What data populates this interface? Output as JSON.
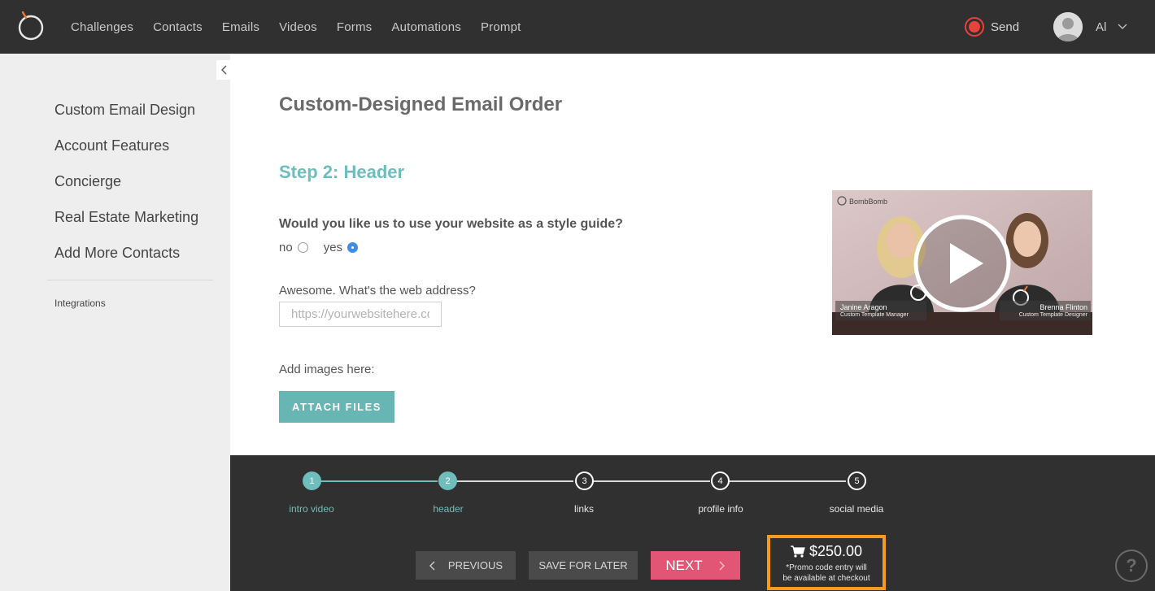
{
  "nav": {
    "items": [
      "Challenges",
      "Contacts",
      "Emails",
      "Videos",
      "Forms",
      "Automations",
      "Prompt"
    ],
    "send_label": "Send",
    "user_name": "Al"
  },
  "sidebar": {
    "items": [
      {
        "label": "Custom Email Design"
      },
      {
        "label": "Account Features"
      },
      {
        "label": "Concierge"
      },
      {
        "label": "Real Estate Marketing"
      },
      {
        "label": "Add More Contacts"
      }
    ],
    "secondary": "Integrations"
  },
  "main": {
    "title": "Custom-Designed Email Order",
    "step_title": "Step 2: Header",
    "question": "Would you like us to use your website as a style guide?",
    "option_no": "no",
    "option_yes": "yes",
    "selected": "yes",
    "web_label": "Awesome. What's the web address?",
    "web_placeholder": "https://yourwebsitehere.com",
    "web_value": "",
    "images_label": "Add images here:",
    "attach_label": "ATTACH FILES"
  },
  "video": {
    "brand": "BombBomb",
    "person_left_name": "Janine Aragon",
    "person_left_role": "Custom Template Manager",
    "person_right_name": "Brenna Flinton",
    "person_right_role": "Custom Template Designer"
  },
  "footer": {
    "steps": [
      {
        "num": "1",
        "label": "intro video",
        "done": true
      },
      {
        "num": "2",
        "label": "header",
        "done": true
      },
      {
        "num": "3",
        "label": "links",
        "done": false
      },
      {
        "num": "4",
        "label": "profile info",
        "done": false
      },
      {
        "num": "5",
        "label": "social media",
        "done": false
      }
    ],
    "previous_label": "PREVIOUS",
    "save_label": "SAVE FOR LATER",
    "next_label": "NEXT",
    "price": "$250.00",
    "promo_line1": "*Promo code entry will",
    "promo_line2": "be available at checkout",
    "help": "?"
  },
  "colors": {
    "topbar": "#2f302f",
    "accent_teal": "#6fbdbd",
    "next_pink": "#e25574",
    "price_border": "#f79a1e",
    "record_red": "#e8433a"
  }
}
